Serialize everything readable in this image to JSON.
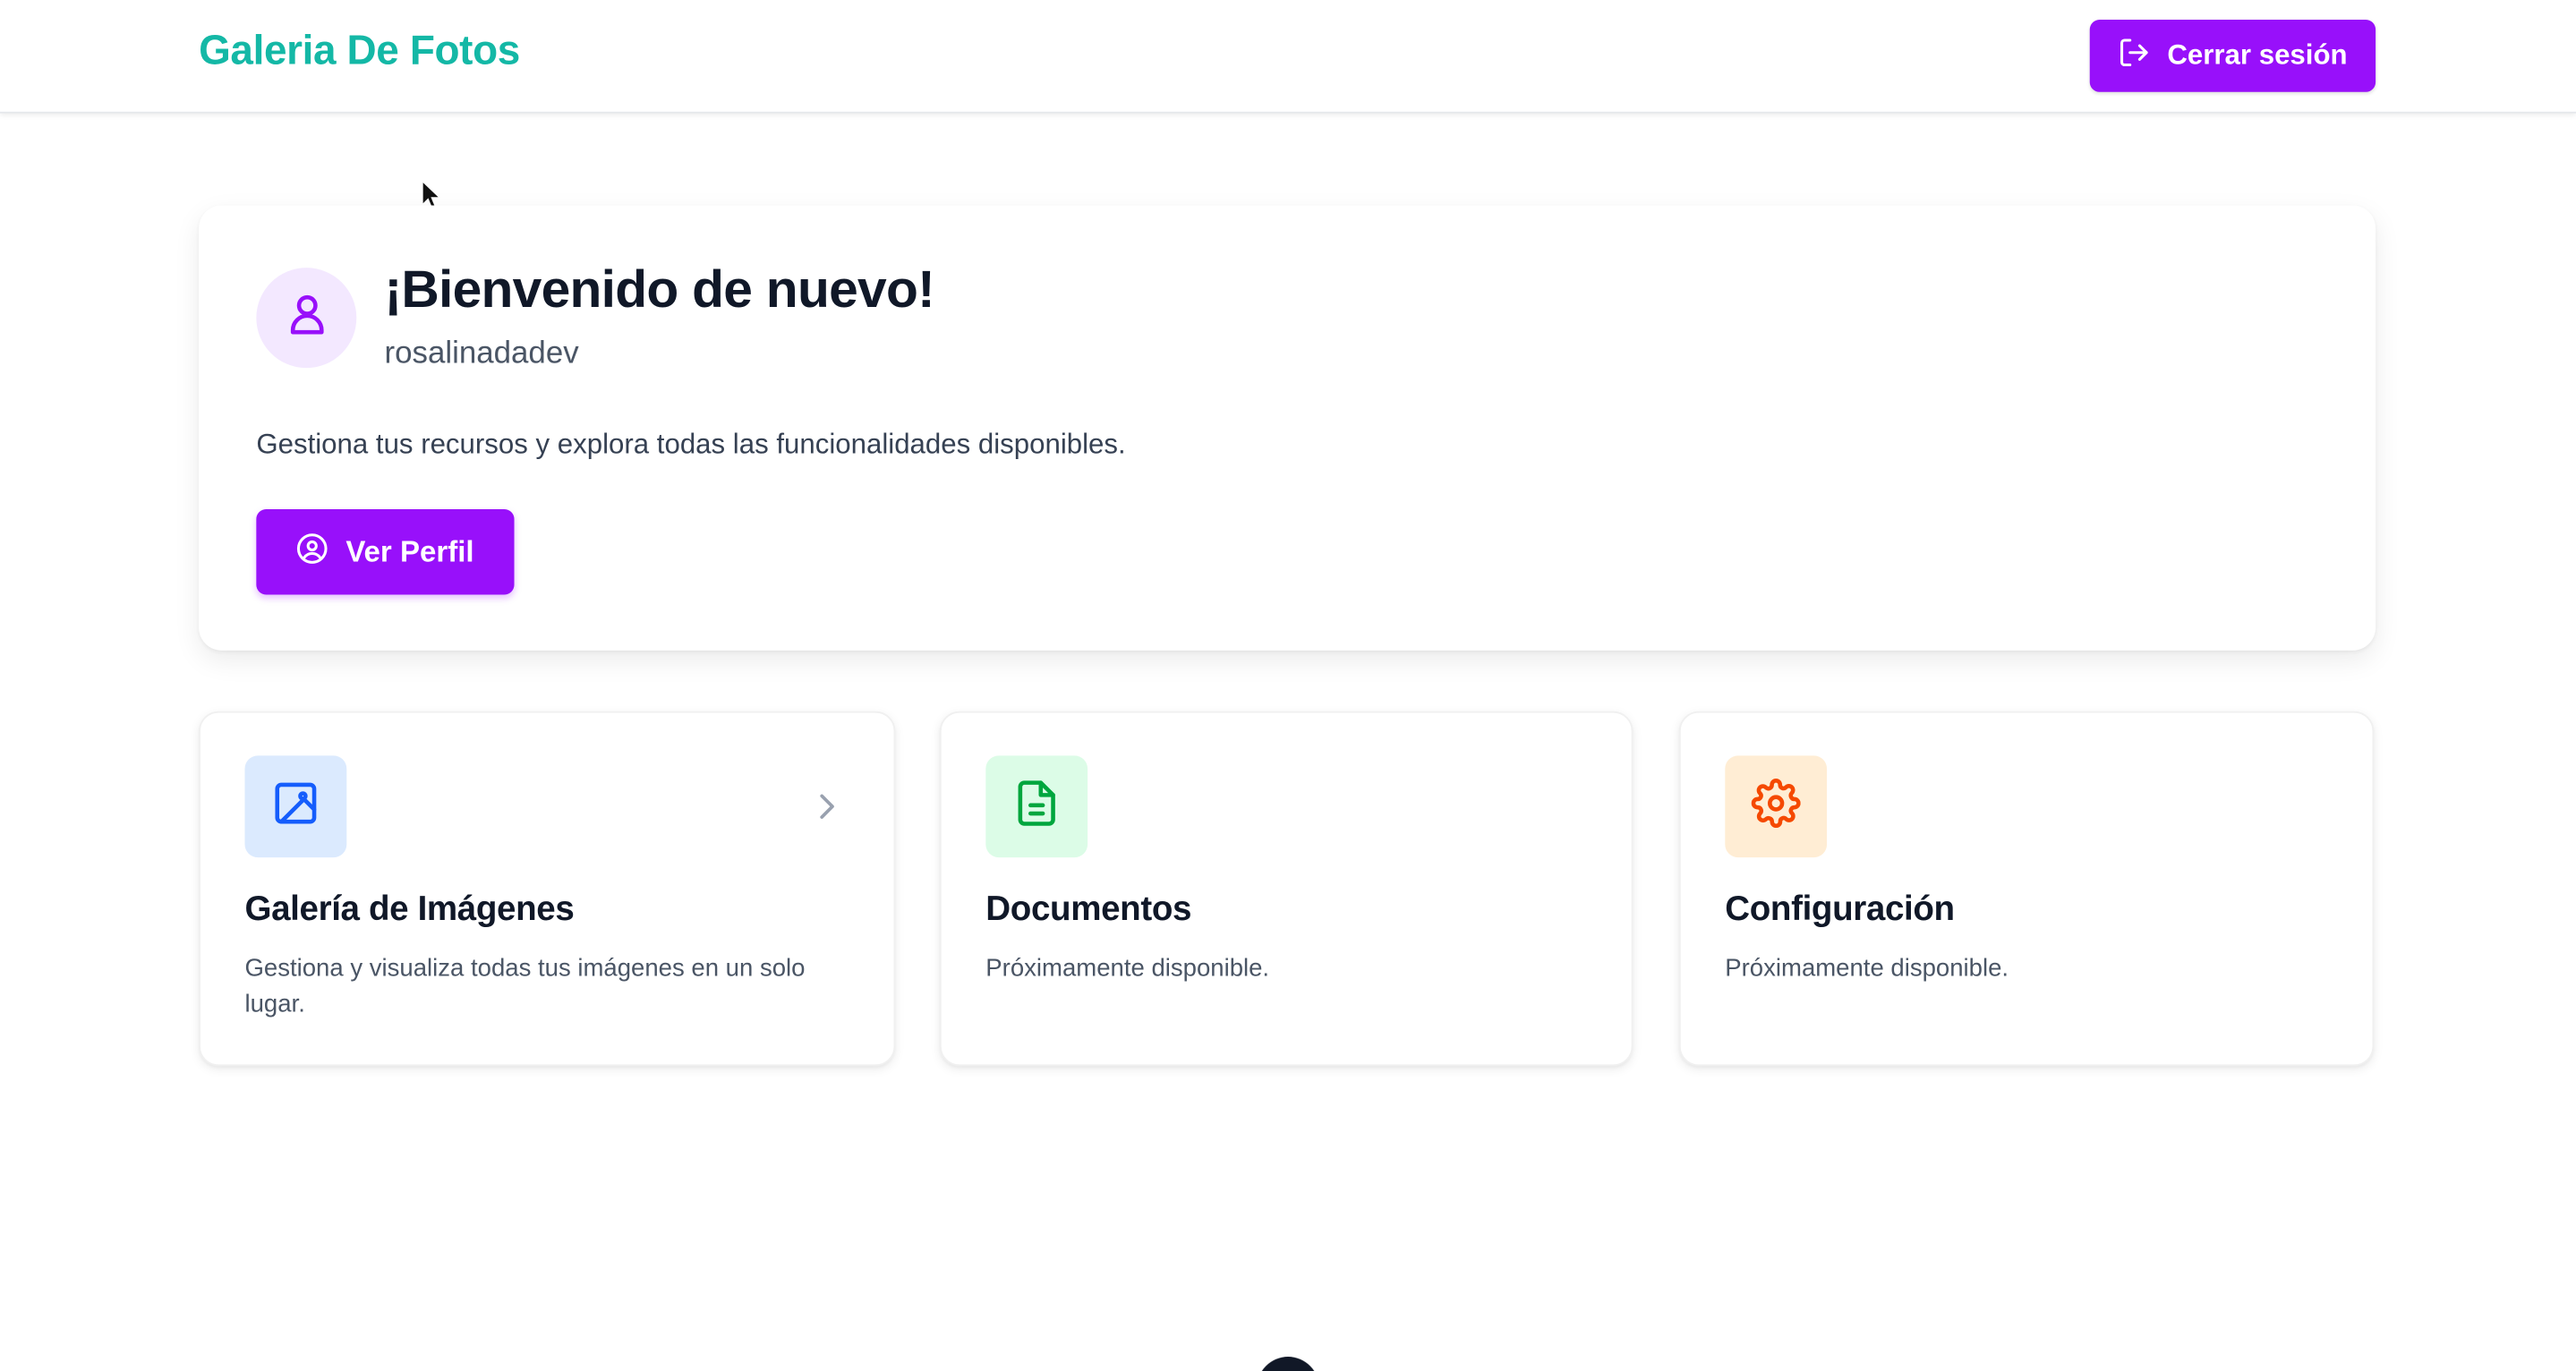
{
  "header": {
    "brand": "Galeria De Fotos",
    "logout_label": "Cerrar sesión"
  },
  "welcome": {
    "title": "¡Bienvenido de nuevo!",
    "username": "rosalinadadev",
    "description": "Gestiona tus recursos y explora todas las funcionalidades disponibles.",
    "profile_button": "Ver Perfil"
  },
  "cards": [
    {
      "title": "Galería de Imágenes",
      "description": "Gestiona y visualiza todas tus imágenes en un solo lugar.",
      "icon": "image-icon",
      "icon_bg": "#dbeafe",
      "icon_color": "#155dfc"
    },
    {
      "title": "Documentos",
      "description": "Próximamente disponible.",
      "icon": "file-text-icon",
      "icon_bg": "#dcfce7",
      "icon_color": "#00a63e"
    },
    {
      "title": "Configuración",
      "description": "Próximamente disponible.",
      "icon": "settings-icon",
      "icon_bg": "#ffedd4",
      "icon_color": "#f54900"
    }
  ],
  "colors": {
    "brand": "#14b8a6",
    "primary": "#9810fa",
    "avatar_bg": "#f3e8ff"
  }
}
